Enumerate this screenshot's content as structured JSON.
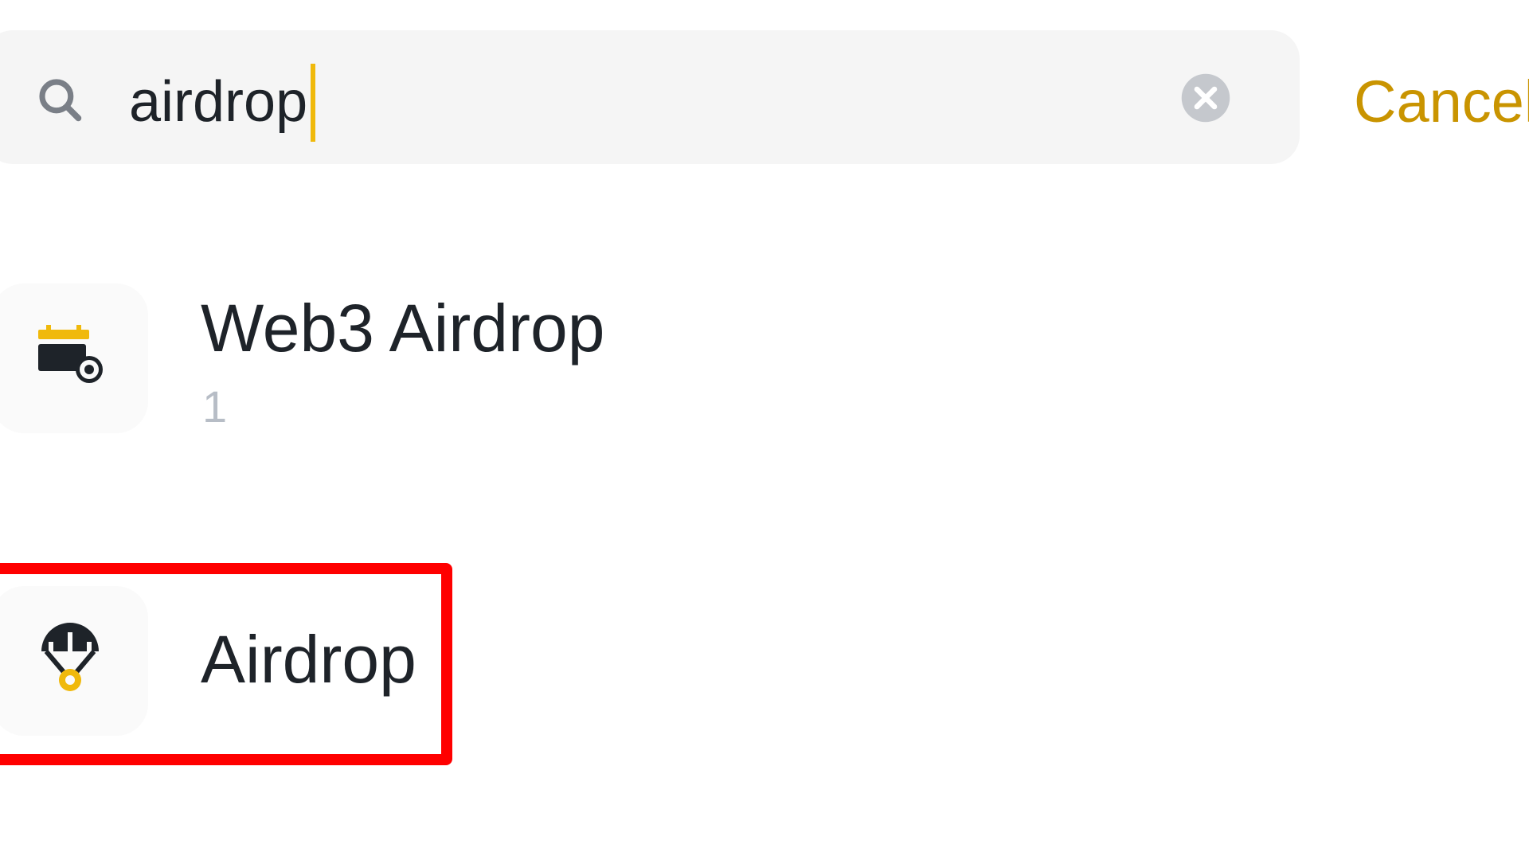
{
  "search": {
    "value": "airdrop",
    "clear_icon": "close-circle-icon",
    "search_icon": "search-icon",
    "cancel_label": "Cancel",
    "accent_color": "#f0b90b",
    "cancel_color": "#c99400"
  },
  "results": [
    {
      "title": "Web3 Airdrop",
      "subtitle": "1",
      "icon": "calendar-add-icon"
    },
    {
      "title": "Airdrop",
      "icon": "parachute-icon"
    }
  ],
  "highlight": {
    "color": "#ff0000",
    "target": "Airdrop"
  }
}
